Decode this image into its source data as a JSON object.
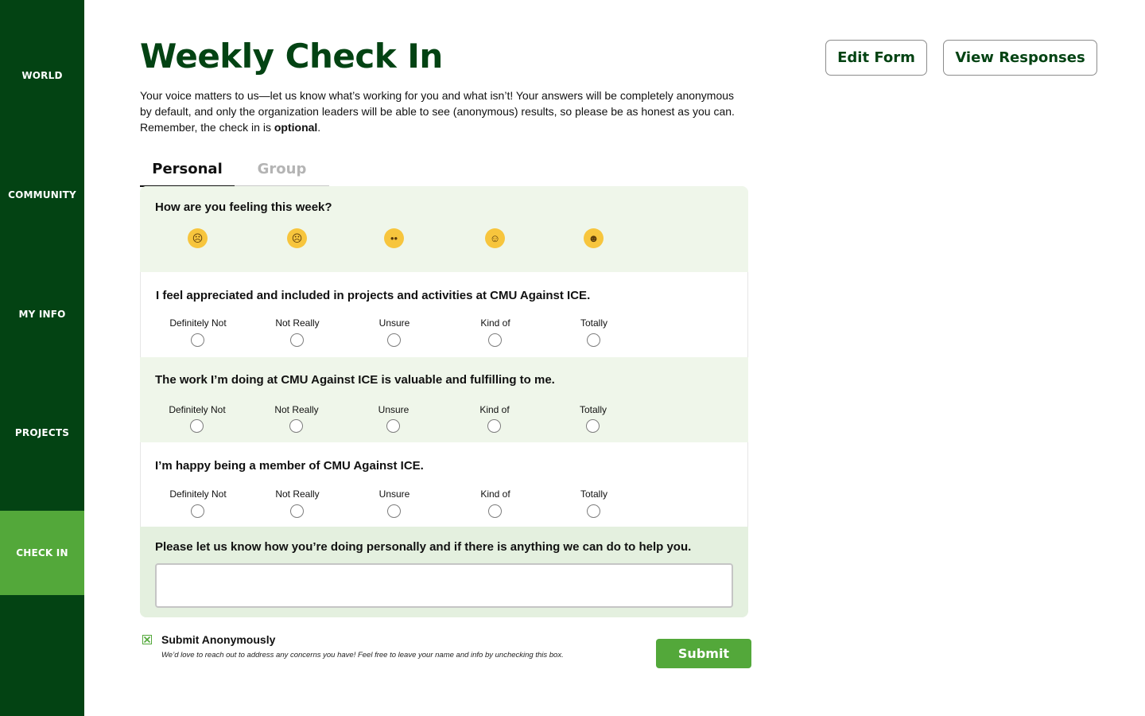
{
  "sidebar": {
    "items": [
      {
        "label": "WORLD"
      },
      {
        "label": "COMMUNITY"
      },
      {
        "label": "MY INFO"
      },
      {
        "label": "PROJECTS"
      },
      {
        "label": "CHECK IN",
        "active": true
      }
    ]
  },
  "header": {
    "title": "Weekly Check In",
    "edit_label": "Edit Form",
    "view_label": "View Responses"
  },
  "intro": {
    "text_before": "Your voice matters to us—let us know what’s working for you and what isn’t! Your answers will be completely anonymous by default, and only the organization leaders will be able to see (anonymous) results, so please be as honest as you can. Remember, the check in is ",
    "bold": "optional",
    "text_after": "."
  },
  "tabs": [
    {
      "label": "Personal",
      "active": true
    },
    {
      "label": "Group",
      "active": false
    }
  ],
  "mood": {
    "question": "How are you feeling this week?",
    "emojis": [
      {
        "icon": "loudly-crying-face-icon",
        "glyph": "☹"
      },
      {
        "icon": "sad-tear-face-icon",
        "glyph": "☹"
      },
      {
        "icon": "neutral-face-icon",
        "glyph": "••"
      },
      {
        "icon": "slight-smile-face-icon",
        "glyph": "☺"
      },
      {
        "icon": "grinning-face-icon",
        "glyph": "☻"
      }
    ]
  },
  "scale_options": [
    "Definitely Not",
    "Not Really",
    "Unsure",
    "Kind of",
    "Totally"
  ],
  "questions": [
    {
      "text": "I feel appreciated and included in projects and activities at CMU Against ICE."
    },
    {
      "text": "The work I’m doing at CMU Against ICE is valuable and fulfilling to me."
    },
    {
      "text": "I’m happy being a member of CMU Against ICE."
    }
  ],
  "comment": {
    "question": "Please let us know how you’re doing personally and if there is anything we can do to help you.",
    "value": "",
    "placeholder": ""
  },
  "footer": {
    "anonymous_label": "Submit Anonymously",
    "anonymous_checked": true,
    "anonymous_note": "We’d love to reach out to address any concerns you have! Feel free to leave your name and info by unchecking this box.",
    "submit_label": "Submit"
  },
  "colors": {
    "sidebar": "#034313",
    "accent": "#53a83a",
    "title": "#034313"
  }
}
